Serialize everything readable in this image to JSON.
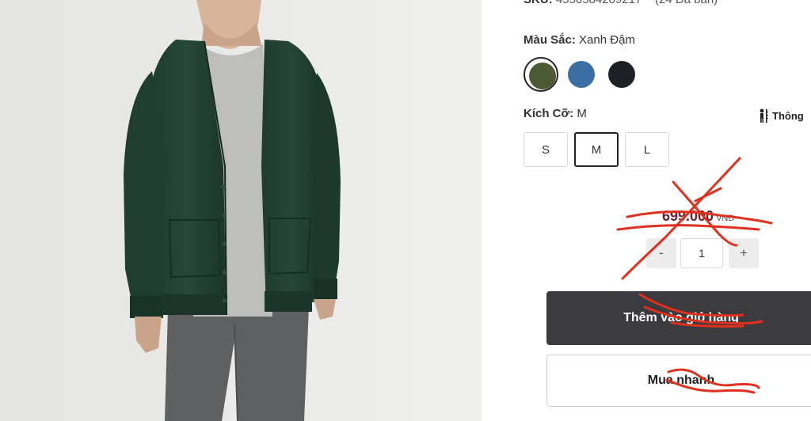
{
  "product": {
    "sku_label": "SKU:",
    "sku_value": "4550584289217",
    "sold_count": "(24 Đã bán)"
  },
  "color": {
    "label": "Màu Sắc:",
    "selected": "Xanh Đậm",
    "swatches": [
      {
        "name": "dark-green",
        "hex": "#4a5a33",
        "selected": true
      },
      {
        "name": "blue",
        "hex": "#3b6fa3",
        "selected": false
      },
      {
        "name": "black",
        "hex": "#1d2126",
        "selected": false
      }
    ]
  },
  "size": {
    "label": "Kích Cỡ:",
    "selected": "M",
    "guide_label": "Thông",
    "options": [
      "S",
      "M",
      "L"
    ]
  },
  "price": {
    "amount": "699.000",
    "currency": "VND"
  },
  "quantity": {
    "minus": "-",
    "value": "1",
    "plus": "+"
  },
  "actions": {
    "add_to_cart": "Thêm vào giỏ hàng",
    "buy_now": "Mua nhanh"
  },
  "colors": {
    "scribble": "#e0301e",
    "primary_button": "#3a3a3f",
    "price": "#6b1f2a"
  }
}
